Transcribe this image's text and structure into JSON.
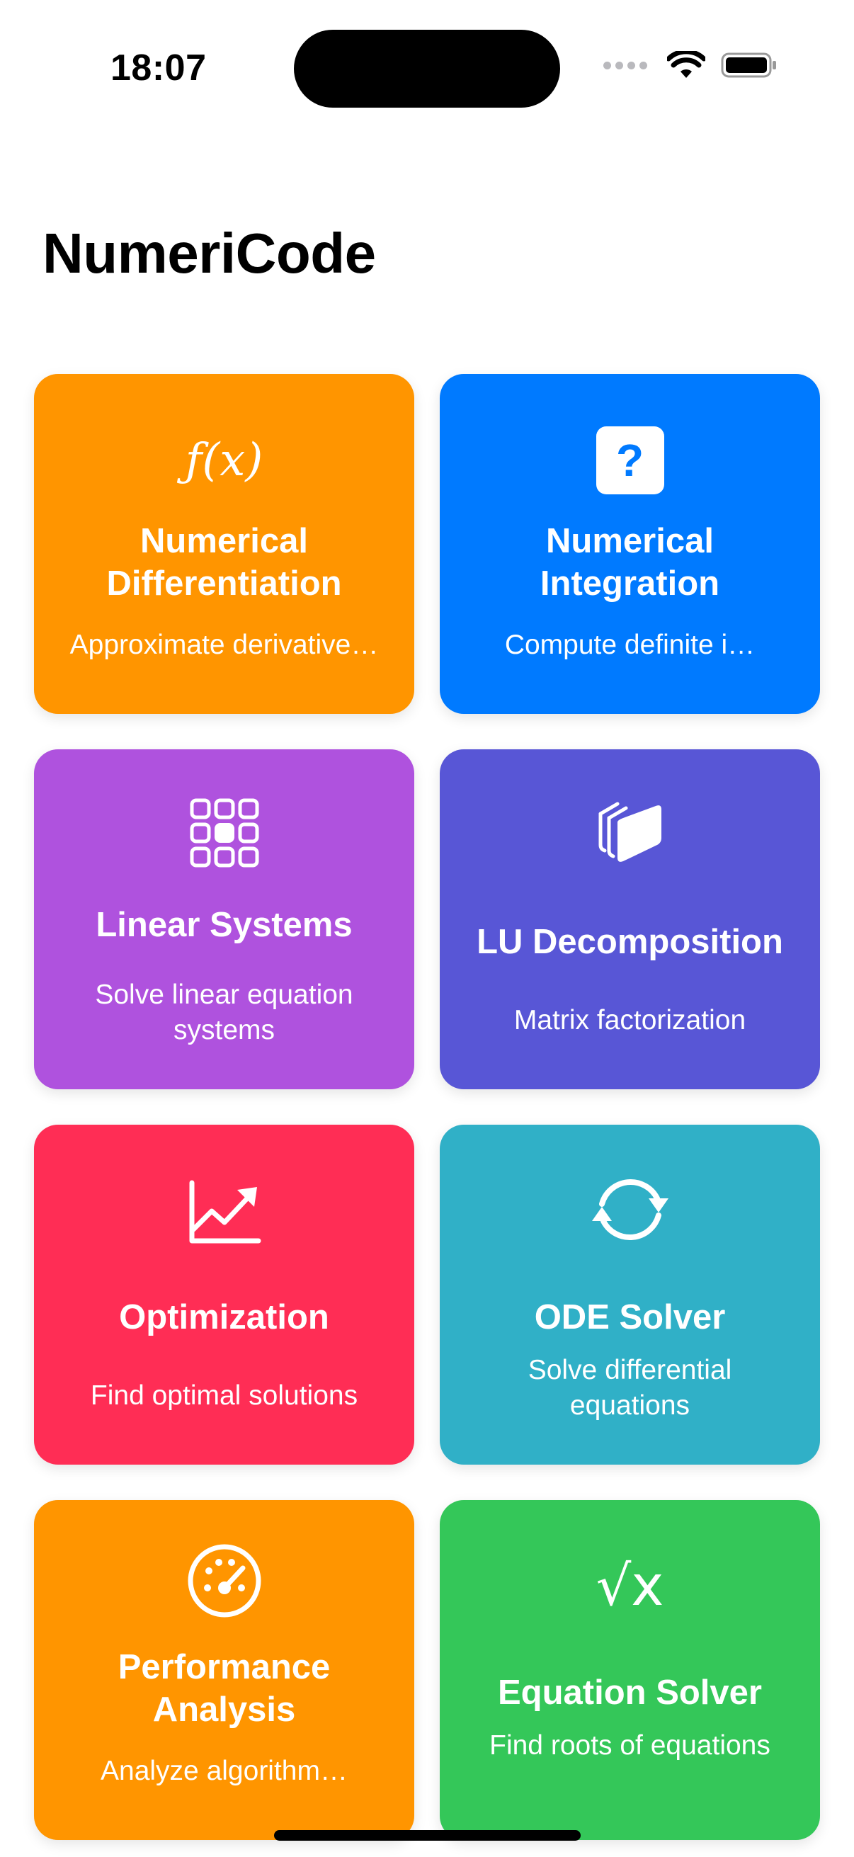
{
  "status_bar": {
    "time": "18:07"
  },
  "header": {
    "title": "NumeriCode"
  },
  "cards": [
    {
      "title": "Numerical Differentiation",
      "subtitle": "Approximate derivative…",
      "icon": "function-icon",
      "icon_text": "ƒ(x)",
      "color": "#FF9500"
    },
    {
      "title": "Numerical Integration",
      "subtitle": "Compute definite i…",
      "icon": "question-square-icon",
      "icon_text": "?",
      "color": "#007AFF"
    },
    {
      "title": "Linear Systems",
      "subtitle": "Solve linear equation systems",
      "icon": "grid-3x3-icon",
      "color": "#AF52DE"
    },
    {
      "title": "LU Decomposition",
      "subtitle": "Matrix factorization",
      "icon": "stacked-squares-icon",
      "color": "#5856D6"
    },
    {
      "title": "Optimization",
      "subtitle": "Find optimal solutions",
      "icon": "chart-trend-up-icon",
      "color": "#FF2D55"
    },
    {
      "title": "ODE Solver",
      "subtitle": "Solve differential equations",
      "icon": "circular-arrows-icon",
      "color": "#30B0C7"
    },
    {
      "title": "Performance Analysis",
      "subtitle": "Analyze algorithm…",
      "icon": "gauge-icon",
      "color": "#FF9500"
    },
    {
      "title": "Equation Solver",
      "subtitle": "Find roots of equations",
      "icon": "square-root-icon",
      "icon_text": "√x",
      "color": "#34C759"
    }
  ]
}
